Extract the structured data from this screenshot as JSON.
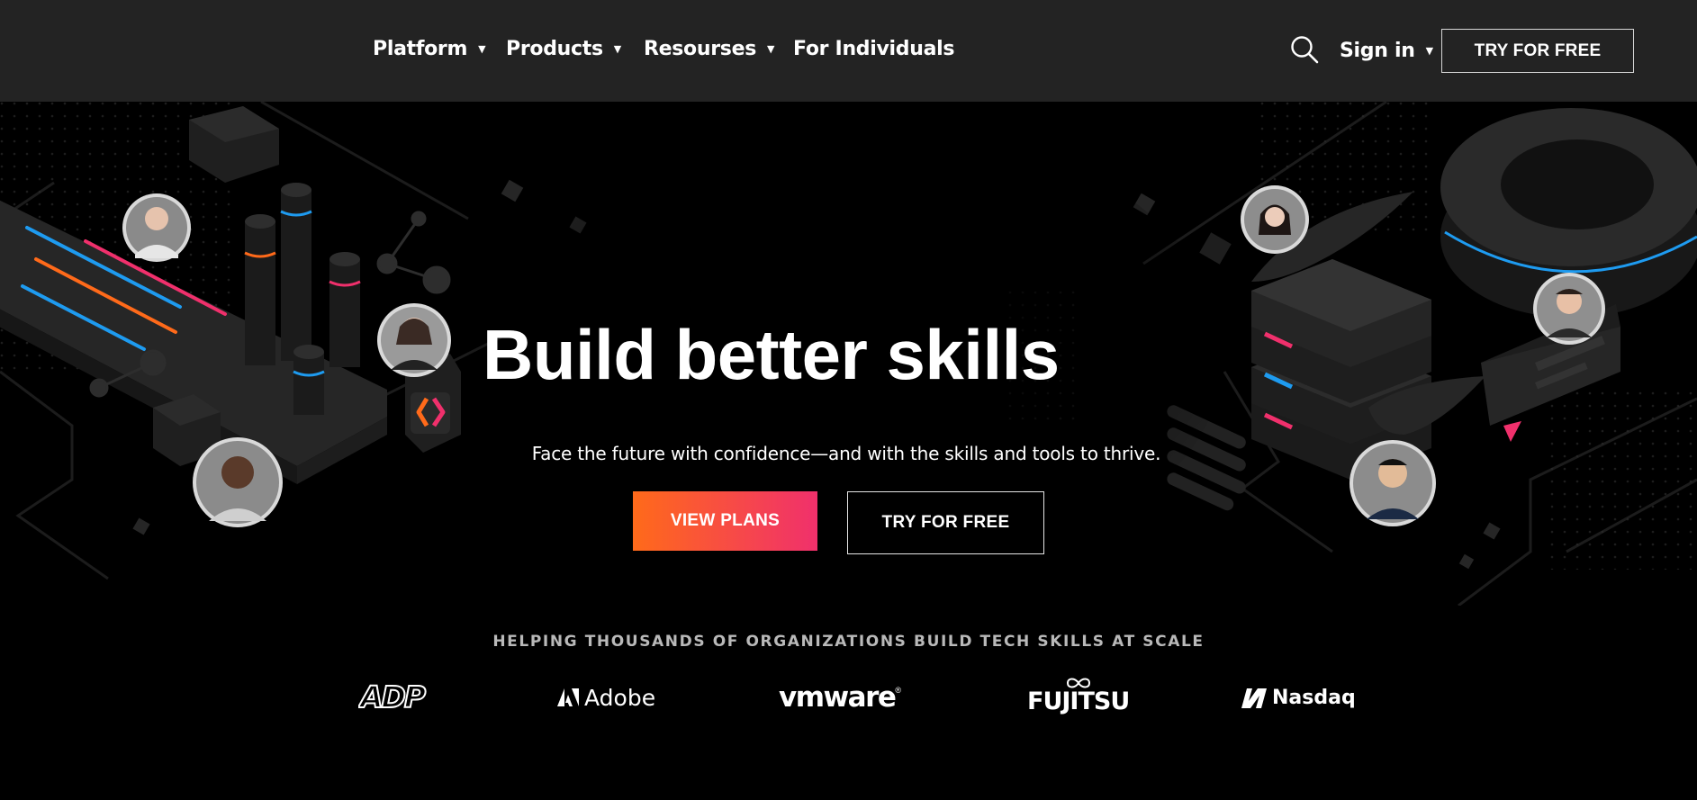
{
  "nav": {
    "items": [
      {
        "label": "Platform",
        "has_dropdown": true
      },
      {
        "label": "Products",
        "has_dropdown": true
      },
      {
        "label": "Resourses",
        "has_dropdown": true
      },
      {
        "label": "For Individuals",
        "has_dropdown": false
      }
    ],
    "search_icon": "search-icon",
    "signin_label": "Sign in",
    "cta_label": "TRY FOR FREE"
  },
  "hero": {
    "headline": "Build better skills",
    "subline": "Face the future with confidence—and with the skills and tools to thrive.",
    "primary_label": "VIEW PLANS",
    "secondary_label": "TRY FOR FREE",
    "colors": {
      "accent_orange": "#ff6a1a",
      "accent_pink": "#f0306c",
      "accent_blue": "#1e9bf0"
    }
  },
  "trust": {
    "heading": "HELPING THOUSANDS OF ORGANIZATIONS BUILD TECH SKILLS AT SCALE",
    "logos": [
      "ADP",
      "Adobe",
      "vmware",
      "FUJITSU",
      "Nasdaq"
    ]
  }
}
